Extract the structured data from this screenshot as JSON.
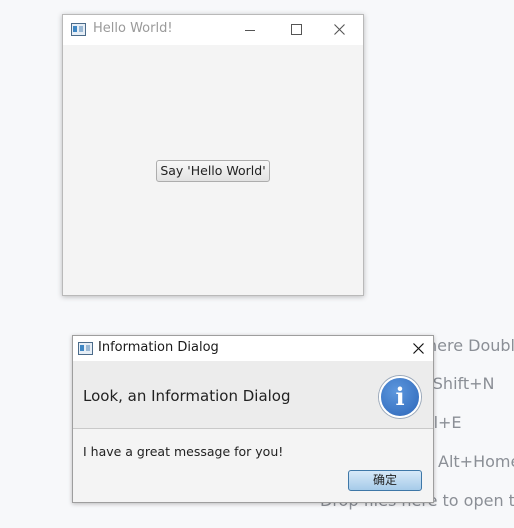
{
  "background_hints": [
    {
      "text": "here Doubl"
    },
    {
      "text": "-Shift+N"
    },
    {
      "text": "rl+E"
    },
    {
      "text": "Alt+Home"
    },
    {
      "text": "Drop files here to open th"
    }
  ],
  "main_window": {
    "title": "Hello World!",
    "button_label": "Say 'Hello World'",
    "icon": "app-window-icon"
  },
  "dialog": {
    "title": "Information Dialog",
    "header": "Look, an Information Dialog",
    "content": "I have a great message for you!",
    "ok_label": "确定",
    "icon": "information-icon",
    "accent": "#2c66b9"
  }
}
